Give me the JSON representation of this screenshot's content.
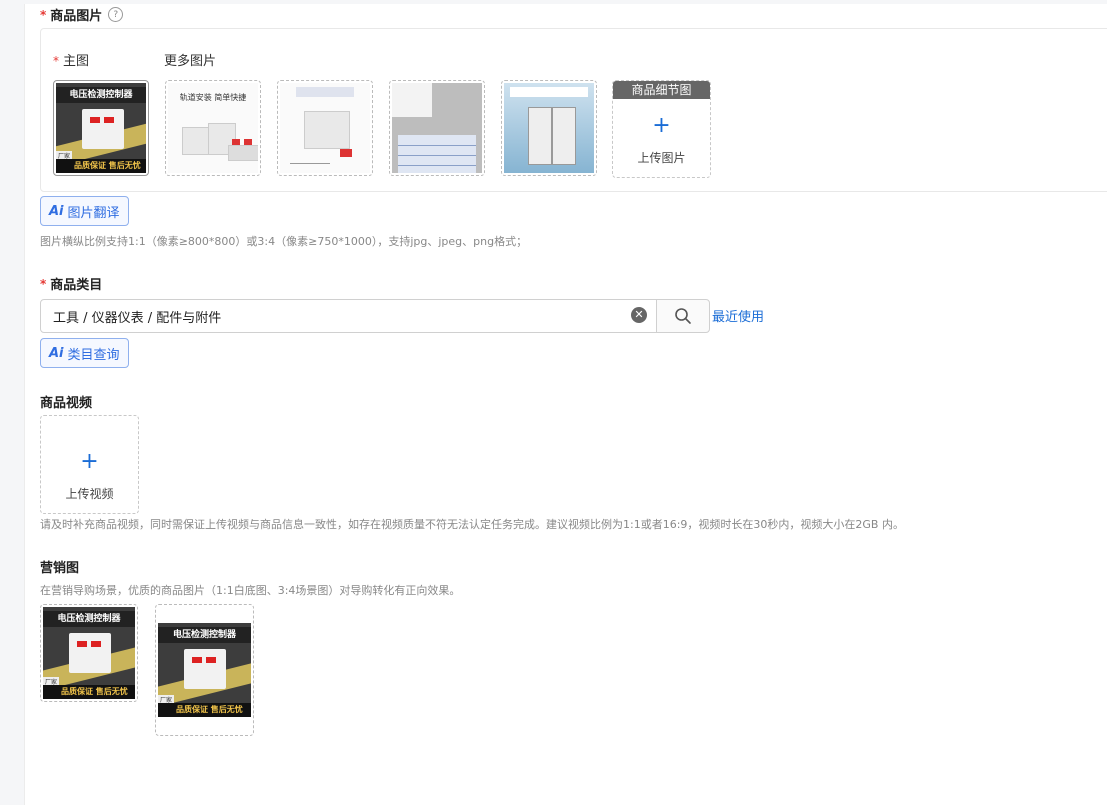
{
  "images_section": {
    "title": "商品图片",
    "main_label": "主图",
    "more_label": "更多图片",
    "detail_header": "商品细节图",
    "upload_label": "上传图片",
    "ai_translate": "图片翻译",
    "ai_mark": "Ai",
    "hint": "图片横纵比例支持1:1（像素≥800*800）或3:4（像素≥750*1000），支持jpg、jpeg、png格式；"
  },
  "product_image": {
    "banner": "电压检测控制器",
    "footer": "品质保证 售后无忧",
    "tag_line1": "厂家",
    "tag_line2": "直销"
  },
  "thumb2_text": "轨道安装 简单快捷",
  "category_section": {
    "title": "商品类目",
    "value": "工具 / 仪器仪表 / 配件与附件",
    "recent": "最近使用",
    "ai_query": "类目查询",
    "ai_mark": "Ai"
  },
  "video_section": {
    "title": "商品视频",
    "upload_label": "上传视频",
    "hint": "请及时补充商品视频，同时需保证上传视频与商品信息一致性，如存在视频质量不符无法认定任务完成。建议视频比例为1:1或者16:9，视频时长在30秒内，视频大小在2GB 内。"
  },
  "marketing_section": {
    "title": "营销图",
    "hint": "在营销导购场景，优质的商品图片（1:1白底图、3:4场景图）对导购转化有正向效果。"
  },
  "colors": {
    "required": "#e53935",
    "accent": "#1a6cd6",
    "ai_border": "#8fb0ee"
  }
}
